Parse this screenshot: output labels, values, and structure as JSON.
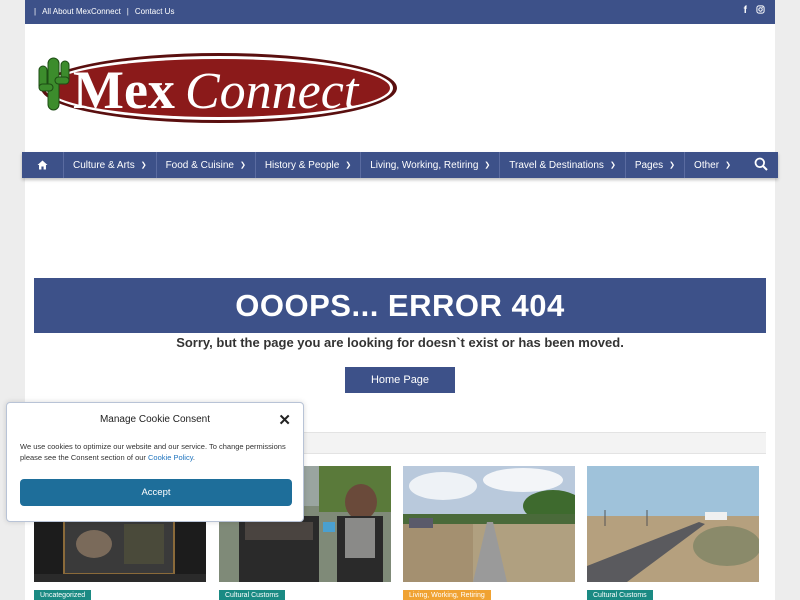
{
  "topbar": {
    "separator": "|",
    "links": [
      "All About MexConnect",
      "Contact Us"
    ],
    "social_icons": [
      "facebook-icon",
      "instagram-icon"
    ]
  },
  "logo": {
    "text_mex": "Mex",
    "text_connect": "Connect",
    "icon": "cactus-icon"
  },
  "nav": {
    "home_icon": "home-icon",
    "items": [
      "Culture & Arts",
      "Food & Cuisine",
      "History & People",
      "Living, Working, Retiring",
      "Travel & Destinations",
      "Pages",
      "Other"
    ],
    "search_icon": "search-icon"
  },
  "error": {
    "title": "OOOPS... ERROR 404",
    "message": "Sorry, but the page you are looking for doesn`t exist or has been moved.",
    "button": "Home Page"
  },
  "cards": [
    {
      "tag": "Uncategorized",
      "tag_color": "#1a8a83"
    },
    {
      "tag": "Cultural Customs",
      "tag_color": "#1a8a83"
    },
    {
      "tag": "Living, Working, Retiring",
      "tag_color": "#f0a232"
    },
    {
      "tag": "Cultural Customs",
      "tag_color": "#1a8a83"
    }
  ],
  "cookie": {
    "title": "Manage Cookie Consent",
    "message": "We use cookies to optimize our website and our service. To change permissions please see the Consent section of our",
    "link": "Cookie Policy",
    "period": ".",
    "accept": "Accept"
  },
  "colors": {
    "brand_blue": "#3d5189",
    "logo_red": "#8b1a1a",
    "accept_blue": "#1e6e9a"
  }
}
